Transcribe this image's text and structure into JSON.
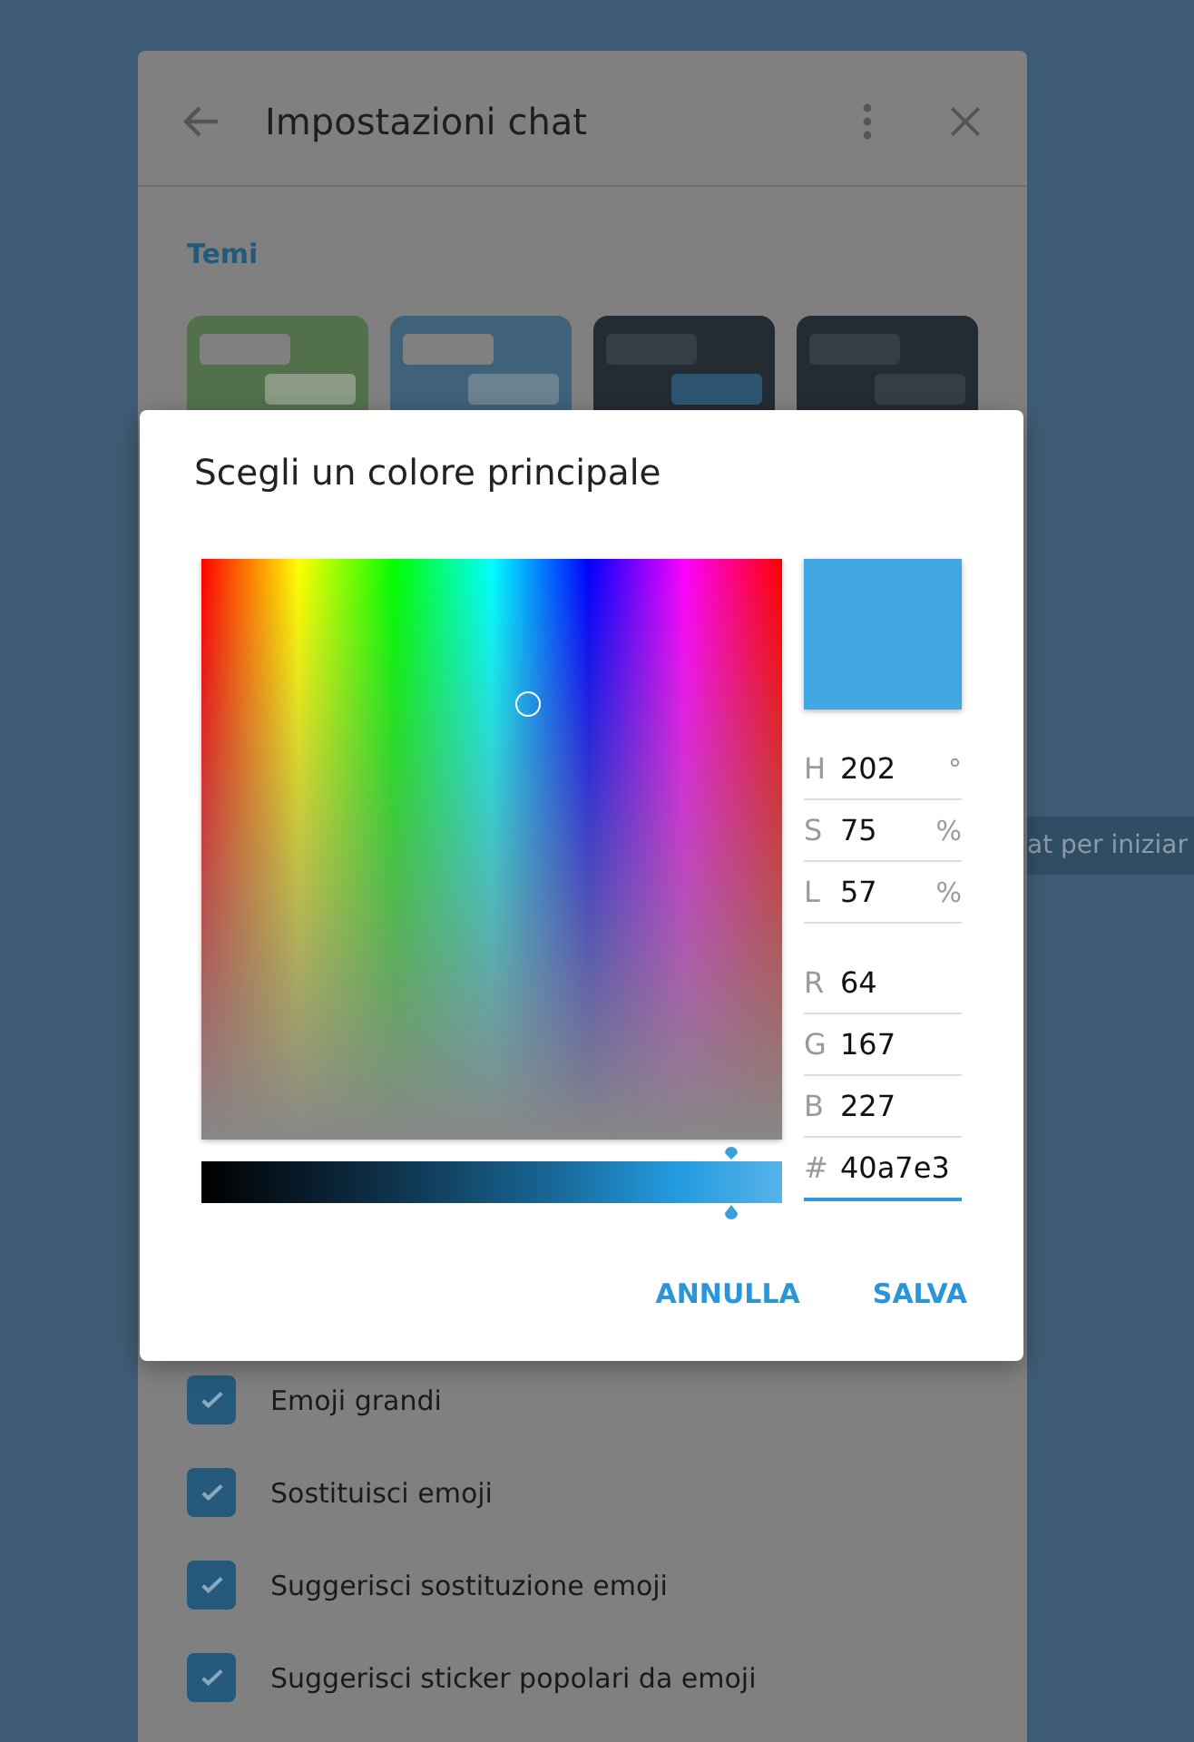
{
  "background_chat": {
    "service_message": "at per iniziar"
  },
  "settings_panel": {
    "title": "Impostazioni chat",
    "section_title": "Temi",
    "themes": [
      {
        "color": "#52704c",
        "bubbles": [
          {
            "color": "#808080"
          },
          {
            "color": "#8a9a84"
          }
        ]
      },
      {
        "color": "#3f627a",
        "bubbles": [
          {
            "color": "#808080"
          },
          {
            "color": "#6c8290"
          }
        ]
      },
      {
        "color": "#232b33",
        "bubbles": [
          {
            "color": "#333e47"
          },
          {
            "color": "#2e5570"
          }
        ]
      },
      {
        "color": "#232b33",
        "bubbles": [
          {
            "color": "#333e47"
          },
          {
            "color": "#333e47"
          }
        ]
      }
    ],
    "options": [
      {
        "label": "Emoji grandi",
        "checked": true
      },
      {
        "label": "Sostituisci emoji",
        "checked": true
      },
      {
        "label": "Suggerisci sostituzione emoji",
        "checked": true
      },
      {
        "label": "Suggerisci sticker popolari da emoji",
        "checked": true
      }
    ]
  },
  "dialog": {
    "title": "Scegli un colore principale",
    "color_plane": {
      "hue": {
        "level": 0.561
      }
    },
    "lightness_slider": {
      "level": 0.913
    },
    "hsl_fields": [
      {
        "label": "H",
        "value": "202",
        "unit": "°"
      },
      {
        "label": "S",
        "value": "75",
        "unit": "%"
      },
      {
        "label": "L",
        "value": "57",
        "unit": "%"
      }
    ],
    "rgb_fields": [
      {
        "label": "R",
        "value": "64"
      },
      {
        "label": "G",
        "value": "167"
      },
      {
        "label": "B",
        "value": "227"
      }
    ],
    "hex_field": {
      "label": "#",
      "value": "40a7e3",
      "focused": true
    },
    "buttons": [
      "ANNULLA",
      "SALVA"
    ]
  }
}
